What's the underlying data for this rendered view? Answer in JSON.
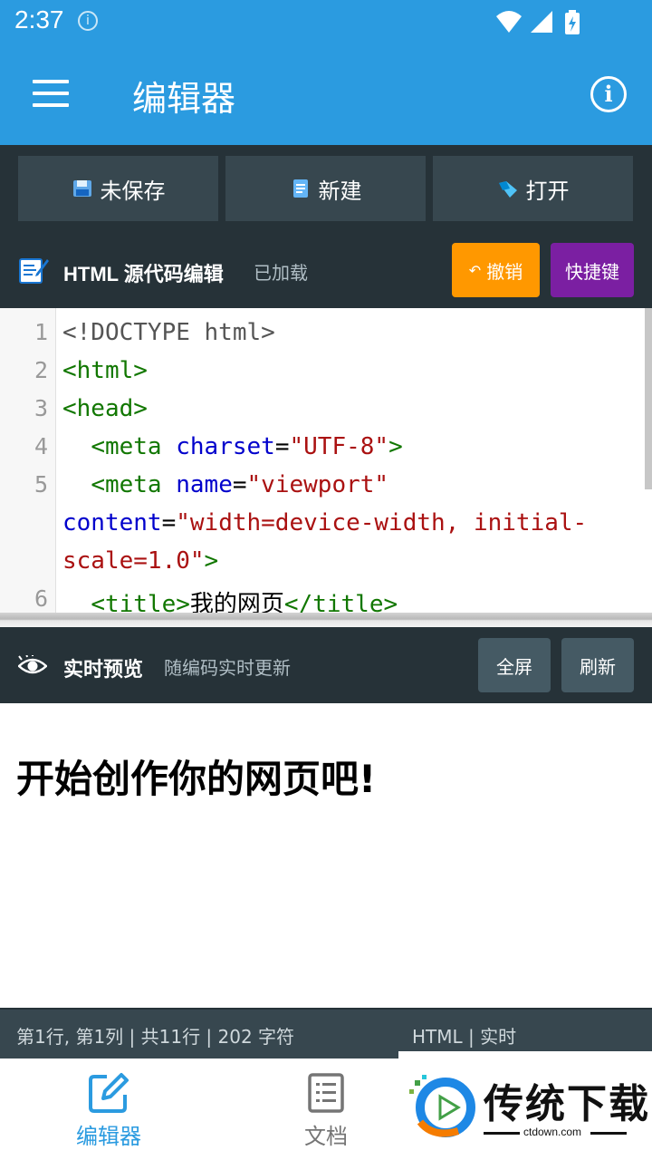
{
  "status_bar": {
    "time": "2:37",
    "info_badge": "i",
    "icons": [
      "wifi-icon",
      "cell-signal-icon",
      "battery-charging-icon"
    ]
  },
  "app_bar": {
    "title": "编辑器",
    "menu_icon": "hamburger-menu-icon",
    "info_icon": "info-circle-icon",
    "info_glyph": "i"
  },
  "toolbar": {
    "unsaved_label": "未保存",
    "new_label": "新建",
    "open_label": "打开"
  },
  "editor_header": {
    "title": "HTML 源代码编辑",
    "status": "已加载",
    "undo_glyph": "↶",
    "undo_label": "撤销",
    "shortcuts_label": "快捷键"
  },
  "code": {
    "line_numbers": [
      "1",
      "2",
      "3",
      "4",
      "5",
      "6"
    ],
    "l1": "<!DOCTYPE html>",
    "l2": "<html>",
    "l3": "<head>",
    "l4": {
      "indent": "  ",
      "open": "<meta",
      "attr": "charset",
      "eq": "=",
      "val": "\"UTF-8\"",
      "close": ">"
    },
    "l5": {
      "indent": "  ",
      "open": "<meta",
      "attr": "name",
      "eq": "=",
      "val": "\"viewport\""
    },
    "l5b": {
      "attr": "content",
      "eq": "=",
      "val": "\"width=device-width, initial-"
    },
    "l5c": {
      "val": "scale=1.0\"",
      "close": ">"
    },
    "l6": {
      "indent": "  ",
      "open": "<title>",
      "text": "我的网页",
      "close": "</title>"
    }
  },
  "preview_bar": {
    "title": "实时预览",
    "subtitle": "随编码实时更新",
    "fullscreen_label": "全屏",
    "refresh_label": "刷新"
  },
  "preview": {
    "heading": "开始创作你的网页吧!"
  },
  "info_bar": {
    "cursor": "第1行, 第1列 | 共11行  |  202 字符",
    "language": "HTML  |  实时"
  },
  "bottom_nav": {
    "editor_label": "编辑器",
    "docs_label": "文档",
    "active": "编辑器"
  },
  "watermark": {
    "text": "传统下载",
    "domain": "ctdown.com"
  },
  "colors": {
    "app_bar": "#2b9be0",
    "dark_panel": "#263238",
    "button": "#37474f",
    "undo": "#ff9800",
    "shortcuts": "#7b1fa2",
    "nav_active": "#2b9be0",
    "nav_inactive": "#757575"
  }
}
